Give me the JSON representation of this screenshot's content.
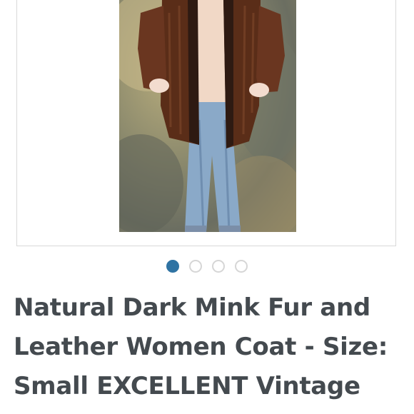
{
  "listing": {
    "photo_alt": "",
    "title": "Natural Dark Mink Fur and Leather Women Coat - Size: Small EXCELLENT Vintage"
  },
  "carousel": {
    "total_images": 4,
    "active_index": 0,
    "active_color": "#2f73a3",
    "inactive_color": "#d6d6d6"
  }
}
